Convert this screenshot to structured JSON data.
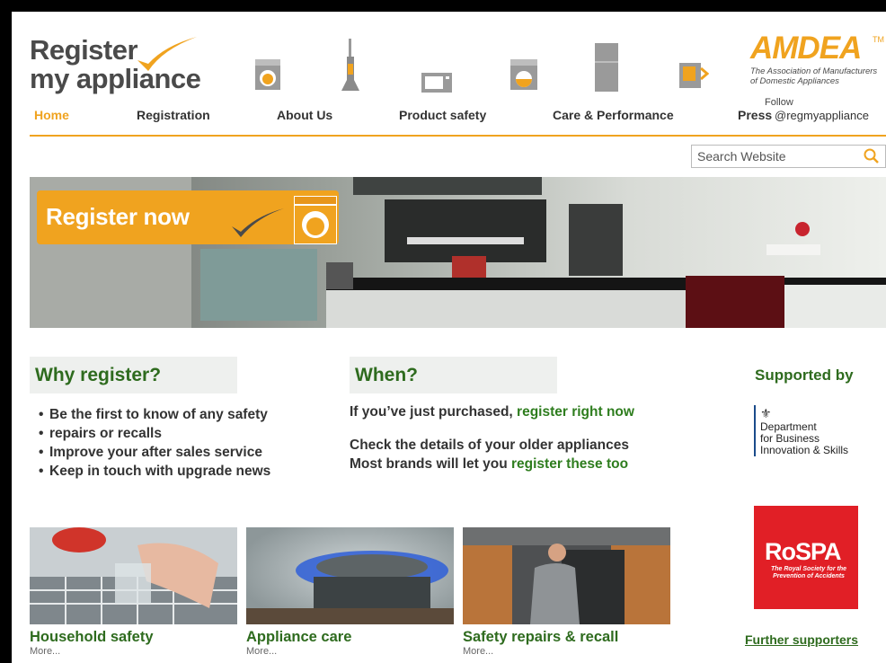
{
  "header": {
    "logo_line1": "Register",
    "logo_line2": "my appliance",
    "amdea_name": "AMDEA",
    "amdea_tm": "TM",
    "amdea_sub1": "The Association of Manufacturers",
    "amdea_sub2": "of Domestic Appliances",
    "follow": "Follow",
    "handle": "@regmyappliance"
  },
  "nav": {
    "home": "Home",
    "registration": "Registration",
    "about": "About Us",
    "product_safety": "Product safety",
    "care": "Care & Performance",
    "press": "Press"
  },
  "search": {
    "placeholder": "Search Website"
  },
  "hero": {
    "register_label": "Register now"
  },
  "why": {
    "heading": "Why register?",
    "items": [
      "Be the first to know of any safety",
      "repairs or recalls",
      "Improve your after sales service",
      "Keep in touch with upgrade news"
    ]
  },
  "when": {
    "heading": "When?",
    "line1_pre": "If you’ve just purchased, ",
    "line1_link": "register right now",
    "line2": "Check the details of your older appliances",
    "line3_pre": "Most brands will let you ",
    "line3_link": "register these too"
  },
  "supporters": {
    "heading": "Supported by",
    "bis_crest": "⚜",
    "bis_l1": "Department",
    "bis_l2": "for Business",
    "bis_l3": "Innovation & Skills",
    "rospa_big": "RoSPA",
    "rospa_small": "The Royal Society for the Prevention of Accidents",
    "further": "Further supporters"
  },
  "tiles": [
    {
      "title": "Household safety",
      "more": "More..."
    },
    {
      "title": "Appliance care",
      "more": "More..."
    },
    {
      "title": "Safety repairs & recall",
      "more": "More..."
    }
  ],
  "colors": {
    "accent": "#f0a31f",
    "green": "#2e6b1e",
    "rospa": "#e11f26"
  }
}
